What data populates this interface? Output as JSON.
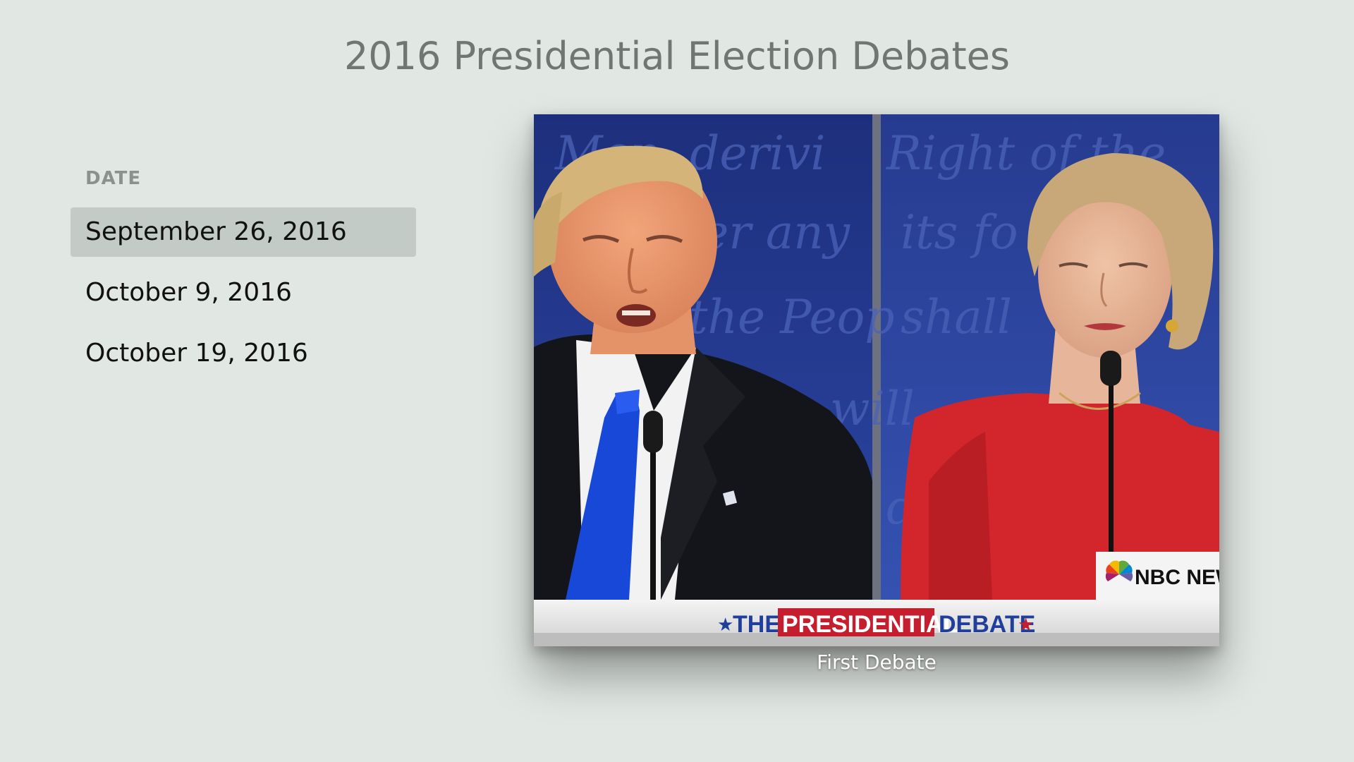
{
  "page": {
    "title": "2016 Presidential Election Debates"
  },
  "sidebar": {
    "section_label": "DATE",
    "items": [
      {
        "label": "September 26, 2016",
        "selected": true
      },
      {
        "label": "October 9, 2016",
        "selected": false
      },
      {
        "label": "October 19, 2016",
        "selected": false
      }
    ]
  },
  "featured": {
    "caption": "First Debate",
    "banner": {
      "the": "THE",
      "presidential": "PRESIDENTIAL",
      "debate": "DEBATE",
      "network": "NBC NEWS"
    },
    "background_script": {
      "left": [
        "Men, derivi",
        "ver any",
        "the Peop",
        "will"
      ],
      "right": [
        "Right of the",
        "its fo",
        "shall",
        "d"
      ]
    }
  },
  "colors": {
    "background": "#e1e7e2",
    "selection": "#c3cbc6",
    "title": "#707772",
    "banner_red": "#c51f2f",
    "banner_blue": "#1f3f9a",
    "backdrop_blue": "#22378a"
  }
}
